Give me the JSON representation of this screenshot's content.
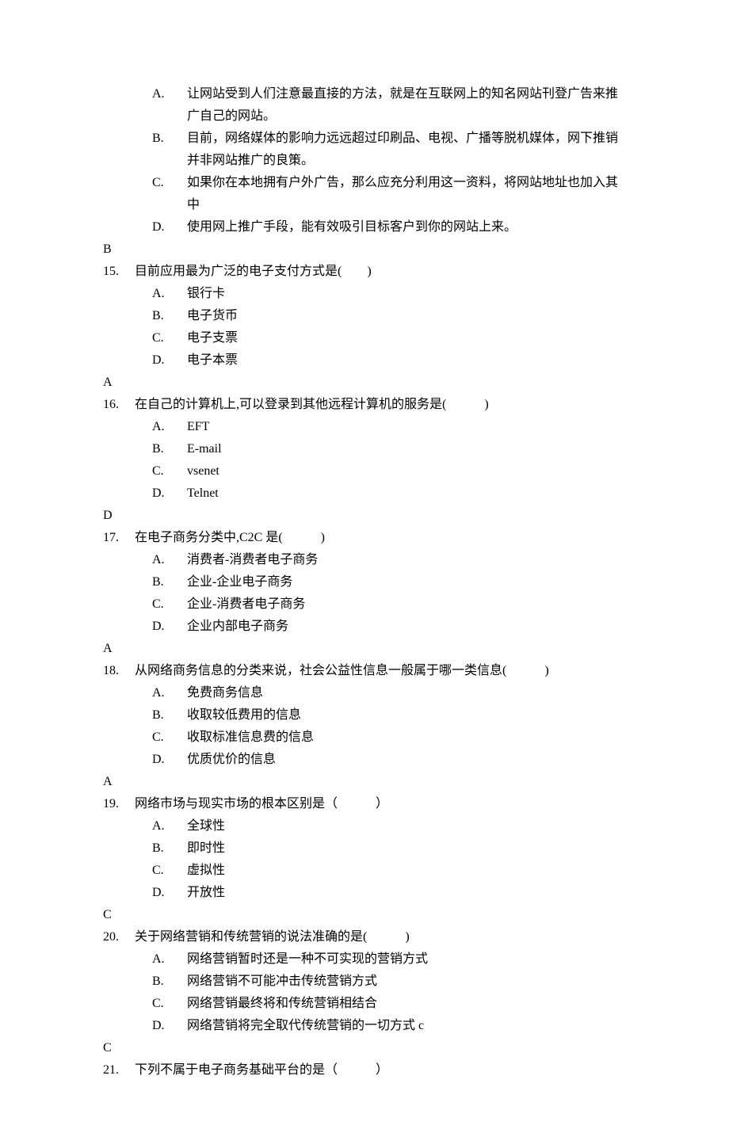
{
  "orphanOptions": [
    {
      "label": "A.",
      "text": "让网站受到人们注意最直接的方法，就是在互联网上的知名网站刊登广告来推广自己的网站。"
    },
    {
      "label": "B.",
      "text": "目前，网络媒体的影响力远远超过印刷品、电视、广播等脱机媒体，网下推销并非网站推广的良策。"
    },
    {
      "label": "C.",
      "text": "如果你在本地拥有户外广告，那么应充分利用这一资料，将网站地址也加入其中"
    },
    {
      "label": "D.",
      "text": "使用网上推广手段，能有效吸引目标客户到你的网站上来。"
    }
  ],
  "orphanAnswer": "B",
  "questions": [
    {
      "num": "15.",
      "text": "目前应用最为广泛的电子支付方式是(　　)",
      "options": [
        {
          "label": "A.",
          "text": "银行卡"
        },
        {
          "label": "B.",
          "text": "电子货币"
        },
        {
          "label": "C.",
          "text": "电子支票"
        },
        {
          "label": "D.",
          "text": "电子本票"
        }
      ],
      "answer": "A"
    },
    {
      "num": "16.",
      "text": "在自己的计算机上,可以登录到其他远程计算机的服务是(　　　)",
      "options": [
        {
          "label": "A.",
          "text": "EFT"
        },
        {
          "label": "B.",
          "text": "E-mail"
        },
        {
          "label": "C.",
          "text": "vsenet"
        },
        {
          "label": "D.",
          "text": "Telnet"
        }
      ],
      "answer": "D"
    },
    {
      "num": "17.",
      "text": "在电子商务分类中,C2C 是(　　　)",
      "options": [
        {
          "label": "A.",
          "text": "消费者-消费者电子商务"
        },
        {
          "label": "B.",
          "text": "企业-企业电子商务"
        },
        {
          "label": "C.",
          "text": "企业-消费者电子商务"
        },
        {
          "label": "D.",
          "text": "企业内部电子商务"
        }
      ],
      "answer": "A"
    },
    {
      "num": "18.",
      "text": "从网络商务信息的分类来说，社会公益性信息一般属于哪一类信息(　　　)",
      "options": [
        {
          "label": "A.",
          "text": "免费商务信息"
        },
        {
          "label": "B.",
          "text": "收取较低费用的信息"
        },
        {
          "label": "C.",
          "text": "收取标准信息费的信息"
        },
        {
          "label": "D.",
          "text": "优质优价的信息"
        }
      ],
      "answer": "A"
    },
    {
      "num": "19.",
      "text": "网络市场与现实市场的根本区别是（　　　）",
      "options": [
        {
          "label": "A.",
          "text": "全球性"
        },
        {
          "label": "B.",
          "text": "即时性"
        },
        {
          "label": "C.",
          "text": "虚拟性"
        },
        {
          "label": "D.",
          "text": "开放性"
        }
      ],
      "answer": "C"
    },
    {
      "num": "20.",
      "text": "关于网络营销和传统营销的说法准确的是(　　　)",
      "options": [
        {
          "label": "A.",
          "text": "网络营销暂时还是一种不可实现的营销方式"
        },
        {
          "label": "B.",
          "text": "网络营销不可能冲击传统营销方式"
        },
        {
          "label": "C.",
          "text": "网络营销最终将和传统营销相结合"
        },
        {
          "label": "D.",
          "text": "网络营销将完全取代传统营销的一切方式 c"
        }
      ],
      "answer": "C"
    },
    {
      "num": "21.",
      "text": "下列不属于电子商务基础平台的是（　　　）",
      "options": [],
      "answer": null
    }
  ]
}
